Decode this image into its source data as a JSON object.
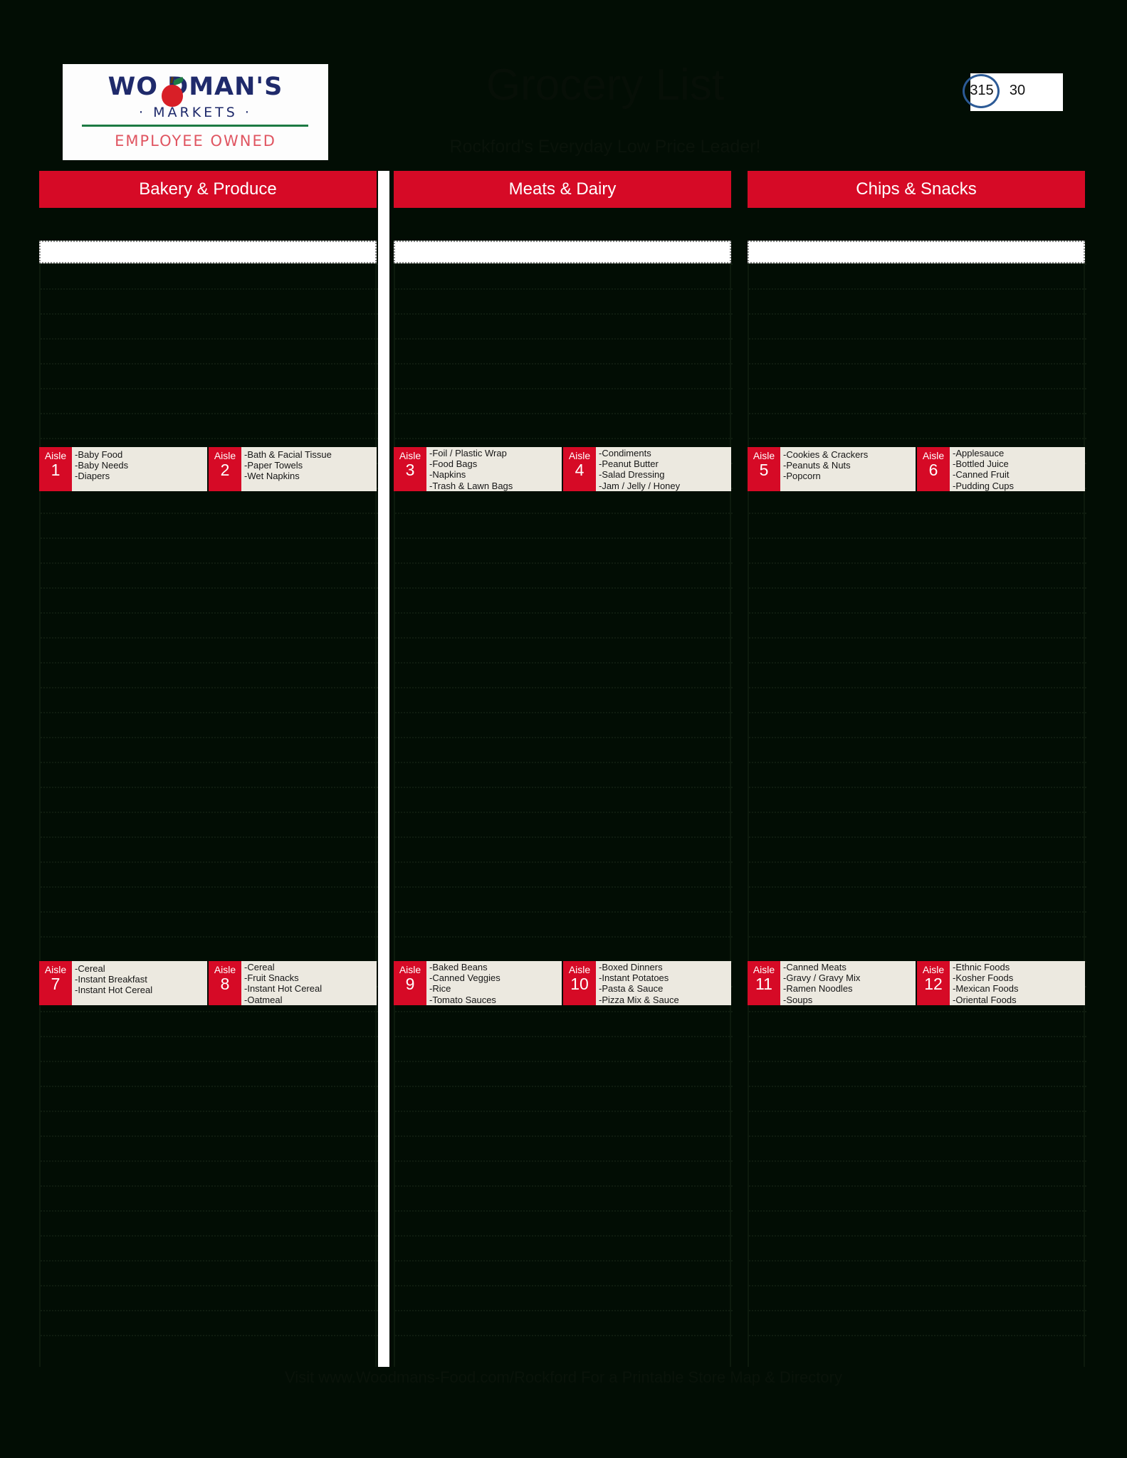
{
  "brand": {
    "wordmark": "WO DMAN'S",
    "wordmark_full": "WOODMAN'S",
    "markets": "MARKETS",
    "tagline": "EMPLOYEE OWNED",
    "apple_icon": "apple-icon",
    "colors": {
      "navy": "#1f2a6b",
      "apple_red": "#d81f27",
      "green": "#1d7a43",
      "tagline_red": "#e05561"
    }
  },
  "header": {
    "title": "Grocery List",
    "subtitle": "Rockford's Everyday Low Price Leader!",
    "page_marker": {
      "primary": "315",
      "secondary": "30",
      "circle_color": "#2c5a96"
    }
  },
  "theme": {
    "background": "#020d04",
    "accent_red": "#d60a26",
    "aisle_panel": "#ece9e0",
    "writebox": "#ffffff"
  },
  "columns": [
    {
      "title": "Bakery & Produce",
      "writebox_value": "",
      "writebox_placeholder": "",
      "aisle_rows": [
        [
          {
            "word": "Aisle",
            "number": "1",
            "items": [
              "-Baby Food",
              "-Baby Needs",
              "-Diapers"
            ]
          },
          {
            "word": "Aisle",
            "number": "2",
            "items": [
              "-Bath & Facial Tissue",
              "-Paper Towels",
              "-Wet Napkins"
            ]
          }
        ],
        [
          {
            "word": "Aisle",
            "number": "7",
            "items": [
              "-Cereal",
              "-Instant Breakfast",
              "-Instant Hot Cereal"
            ]
          },
          {
            "word": "Aisle",
            "number": "8",
            "items": [
              "-Cereal",
              "-Fruit Snacks",
              "-Instant Hot Cereal",
              "-Oatmeal"
            ]
          }
        ]
      ]
    },
    {
      "title": "Meats & Dairy",
      "writebox_value": "",
      "writebox_placeholder": "",
      "aisle_rows": [
        [
          {
            "word": "Aisle",
            "number": "3",
            "items": [
              "-Foil / Plastic Wrap",
              "-Food Bags",
              "-Napkins",
              "-Trash & Lawn Bags"
            ]
          },
          {
            "word": "Aisle",
            "number": "4",
            "items": [
              "-Condiments",
              "-Peanut Butter",
              "-Salad Dressing",
              "-Jam / Jelly / Honey"
            ]
          }
        ],
        [
          {
            "word": "Aisle",
            "number": "9",
            "items": [
              "-Baked Beans",
              "-Canned Veggies",
              "-Rice",
              "-Tomato Sauces"
            ]
          },
          {
            "word": "Aisle",
            "number": "10",
            "items": [
              "-Boxed Dinners",
              "-Instant Potatoes",
              "-Pasta & Sauce",
              "-Pizza Mix & Sauce"
            ]
          }
        ]
      ]
    },
    {
      "title": "Chips & Snacks",
      "writebox_value": "",
      "writebox_placeholder": "",
      "aisle_rows": [
        [
          {
            "word": "Aisle",
            "number": "5",
            "items": [
              "-Cookies & Crackers",
              "-Peanuts & Nuts",
              "-Popcorn"
            ]
          },
          {
            "word": "Aisle",
            "number": "6",
            "items": [
              "-Applesauce",
              "-Bottled Juice",
              "-Canned Fruit",
              "-Pudding Cups"
            ]
          }
        ],
        [
          {
            "word": "Aisle",
            "number": "11",
            "items": [
              "-Canned Meats",
              "-Gravy / Gravy Mix",
              "-Ramen Noodles",
              "-Soups"
            ]
          },
          {
            "word": "Aisle",
            "number": "12",
            "items": [
              "-Ethnic Foods",
              "-Kosher Foods",
              "-Mexican Foods",
              "-Oriental Foods"
            ]
          }
        ]
      ]
    }
  ],
  "footer": {
    "text": "Visit www.Woodmans-Food.com/Rockford For a Printable Store Map & Directory"
  }
}
